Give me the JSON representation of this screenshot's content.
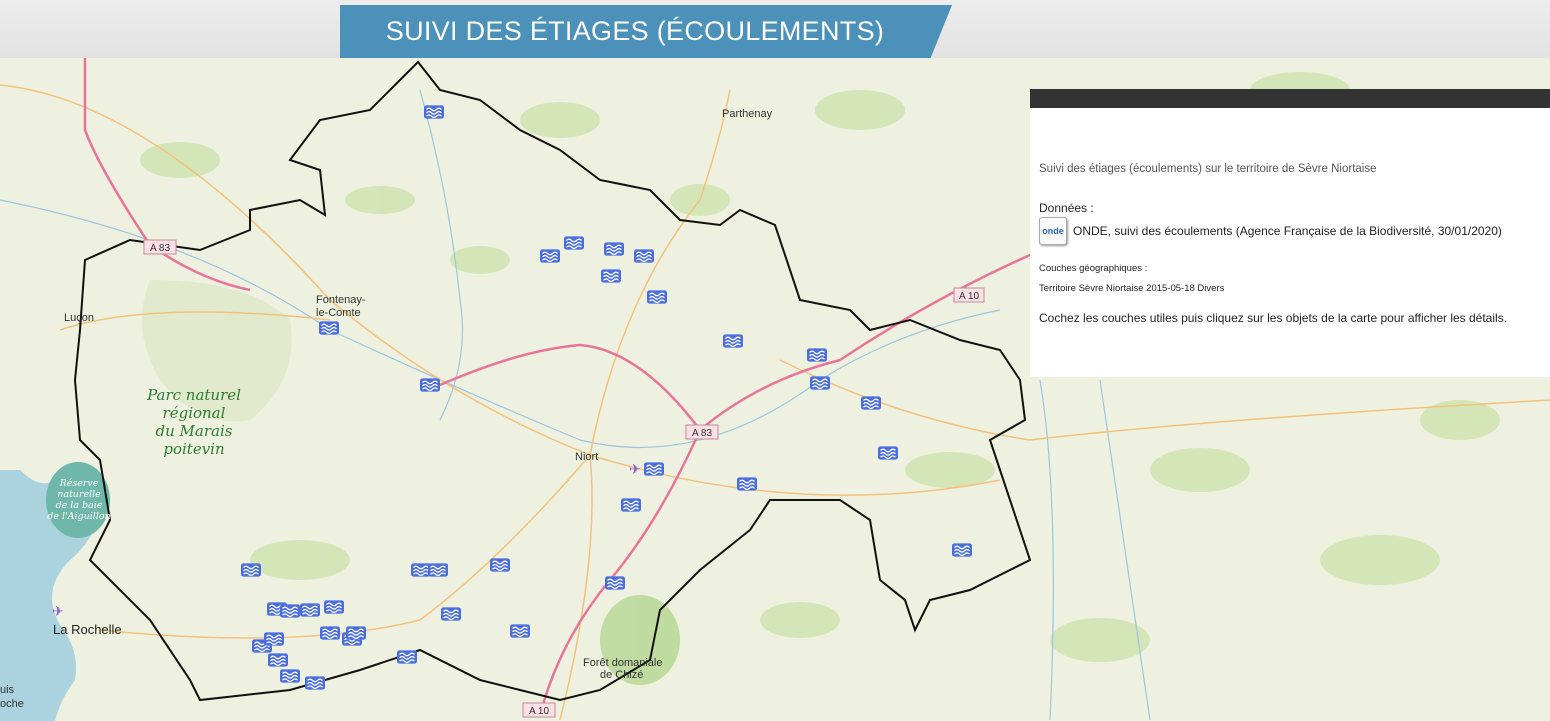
{
  "header": {
    "title": "SUIVI DES ÉTIAGES (ÉCOULEMENTS)"
  },
  "map": {
    "places": {
      "parthenay": "Parthenay",
      "fontenay_1": "Fontenay-",
      "fontenay_2": "le-Comte",
      "lucon": "Luçon",
      "niort": "Niort",
      "la_rochelle": "La Rochelle",
      "foret_1": "Forêt domaniale",
      "foret_2": "de Chizé",
      "cut_left_1": "uis",
      "cut_left_2": "oche"
    },
    "park": {
      "line1": "Parc naturel",
      "line2": "régional",
      "line3": "du Marais",
      "line4": "poitevin"
    },
    "reserve": {
      "line1": "Réserve",
      "line2": "naturelle",
      "line3": "de la baie",
      "line4": "de l'Aiguillon"
    },
    "roads": {
      "a83_west": "A 83",
      "a83_east": "A 83",
      "a10_east": "A 10",
      "a10_south": "A 10"
    },
    "colors": {
      "territory": "#111111",
      "motorway": "#e8749a",
      "water": "#aad3df",
      "marker": "#4a6ee0",
      "forest": "#c8e0a8"
    }
  },
  "panel": {
    "intro": "Suivi des étiages (écoulements) sur le territoire de Sèvre Niortaise",
    "donnees_label": "Données :",
    "onde_logo": "onde",
    "onde_text": "ONDE, suivi des écoulements (Agence Française de la Biodiversité, 30/01/2020)",
    "couches_label": "Couches géographiques :",
    "territoire": "Territoire Sèvre Niortaise 2015-05-18 Divers",
    "help": "Cochez les couches utiles puis cliquez sur les objets de la carte pour afficher les détails."
  }
}
